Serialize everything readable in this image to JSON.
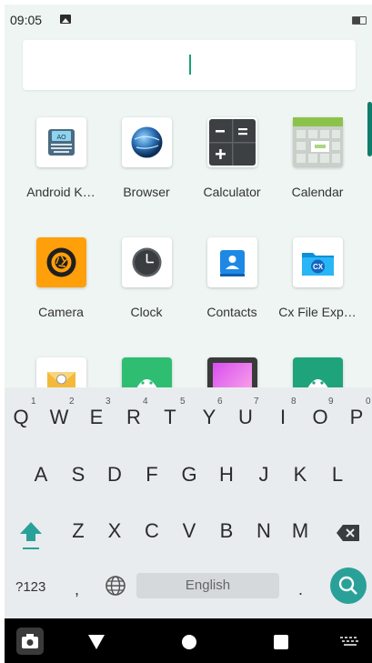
{
  "status_bar": {
    "time": "09:05"
  },
  "apps": [
    {
      "label": "Android K…",
      "icon": "android-keyboard-icon"
    },
    {
      "label": "Browser",
      "icon": "browser-globe-icon"
    },
    {
      "label": "Calculator",
      "icon": "calculator-icon"
    },
    {
      "label": "Calendar",
      "icon": "calendar-icon"
    },
    {
      "label": "Camera",
      "icon": "camera-icon"
    },
    {
      "label": "Clock",
      "icon": "clock-icon"
    },
    {
      "label": "Contacts",
      "icon": "contacts-icon"
    },
    {
      "label": "Cx File Exp…",
      "icon": "cx-file-explorer-icon"
    },
    {
      "label": "",
      "icon": "email-icon"
    },
    {
      "label": "",
      "icon": "android-app-icon"
    },
    {
      "label": "",
      "icon": "gallery-icon"
    },
    {
      "label": "",
      "icon": "android-app-icon"
    }
  ],
  "keyboard": {
    "row1": [
      "Q",
      "W",
      "E",
      "R",
      "T",
      "Y",
      "U",
      "I",
      "O",
      "P"
    ],
    "row1_hints": [
      "1",
      "2",
      "3",
      "4",
      "5",
      "6",
      "7",
      "8",
      "9",
      "0"
    ],
    "row2": [
      "A",
      "S",
      "D",
      "F",
      "G",
      "H",
      "J",
      "K",
      "L"
    ],
    "row3": [
      "Z",
      "X",
      "C",
      "V",
      "B",
      "N",
      "M"
    ],
    "symbols_label": "?123",
    "comma_label": ",",
    "period_label": ".",
    "space_label": "English"
  },
  "icons": {
    "shift": "shift-up-arrow-icon",
    "backspace": "backspace-icon",
    "language": "globe-icon",
    "search": "search-icon",
    "nav_screenshot": "camera-icon",
    "nav_back": "back-triangle-icon",
    "nav_home": "home-circle-icon",
    "nav_recents": "recents-square-icon",
    "nav_keyboard": "keyboard-icon"
  },
  "colors": {
    "accent": "#2aa198",
    "cursor": "#18a078",
    "drawer_bg": "#eef5f3",
    "keyboard_bg": "#e8ecef"
  }
}
